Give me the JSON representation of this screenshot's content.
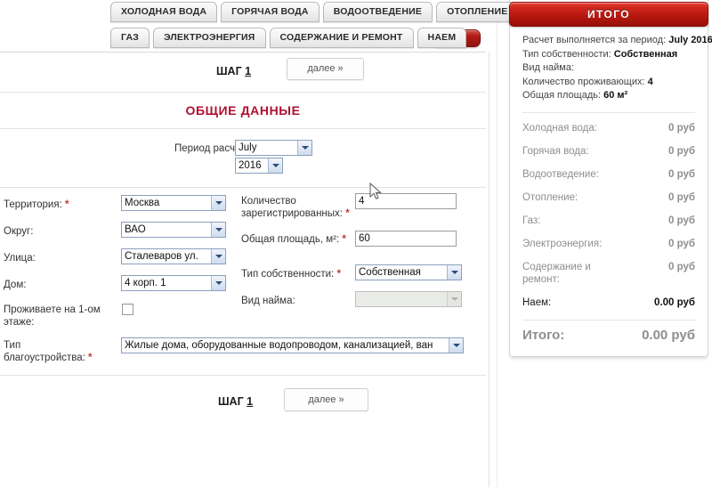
{
  "tabs": {
    "row1": [
      "ХОЛОДНАЯ ВОДА",
      "ГОРЯЧАЯ ВОДА",
      "ВОДООТВЕДЕНИЕ",
      "ОТОПЛЕНИЕ"
    ],
    "row2": [
      "ГАЗ",
      "ЭЛЕКТРОЭНЕРГИЯ",
      "СОДЕРЖАНИЕ И РЕМОНТ",
      "НАЕМ"
    ]
  },
  "form": {
    "step_label": "ШАГ",
    "step_number": "1",
    "next_label": "далее »",
    "section_title": "ОБЩИЕ ДАННЫЕ",
    "period_label": "Период расчета:",
    "period_month": "July",
    "period_year": "2016",
    "left": {
      "territory_label": "Территория:",
      "territory_value": "Москва",
      "district_label": "Округ:",
      "district_value": "ВАО",
      "street_label": "Улица:",
      "street_value": "Сталеваров ул.",
      "house_label": "Дом:",
      "house_value": "4 корп. 1",
      "firstfloor_label_1": "Проживаете на 1-ом",
      "firstfloor_label_2": "этаже:",
      "amenity_label_1": "Тип",
      "amenity_label_2": "благоустройства:",
      "amenity_value": "Жилые дома, оборудованные водопроводом, канализацией, ван"
    },
    "right": {
      "registered_label_1": "Количество",
      "registered_label_2": "зарегистрированных:",
      "registered_value": "4",
      "area_label": "Общая площадь, м²:",
      "area_value": "60",
      "ownership_label": "Тип собственности:",
      "ownership_value": "Собственная",
      "rental_label": "Вид найма:",
      "rental_value": ""
    },
    "required_mark": "*"
  },
  "panel": {
    "title": "ИТОГО",
    "summary": [
      {
        "label": "Расчет выполняется за период:",
        "value": "July 2016"
      },
      {
        "label": "Тип собственности:",
        "value": "Собственная"
      },
      {
        "label": "Вид найма:",
        "value": ""
      },
      {
        "label": "Количество проживающих:",
        "value": "4"
      },
      {
        "label": "Общая площадь:",
        "value": "60 м²"
      }
    ],
    "rows": [
      {
        "name": "Холодная вода:",
        "value": "0 руб"
      },
      {
        "name": "Горячая вода:",
        "value": "0 руб"
      },
      {
        "name": "Водоотведение:",
        "value": "0 руб"
      },
      {
        "name": "Отопление:",
        "value": "0 руб"
      },
      {
        "name": "Газ:",
        "value": "0 руб"
      },
      {
        "name": "Электроэнергия:",
        "value": "0 руб"
      },
      {
        "name": "Содержание и ремонт:",
        "value": "0 руб"
      }
    ],
    "rent_row": {
      "name": "Наем:",
      "value": "0.00 руб"
    },
    "total_row": {
      "name": "Итого:",
      "value": "0.00 руб"
    }
  },
  "colors": {
    "accent_red": "#b01030",
    "panel_red": "#b81810",
    "required": "#c0392b"
  }
}
